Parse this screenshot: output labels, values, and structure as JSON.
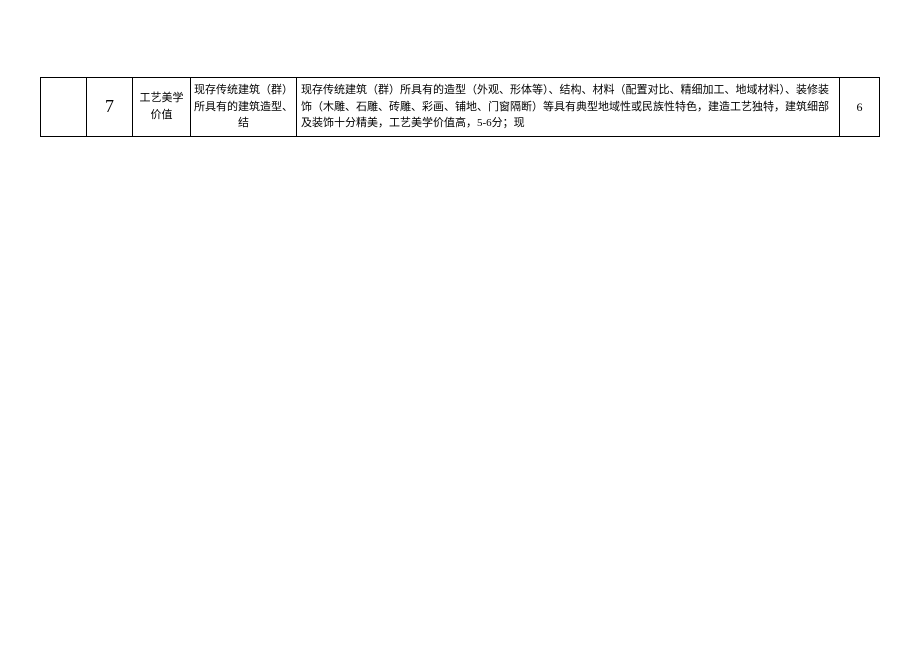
{
  "table": {
    "row": {
      "blank": "",
      "num": "7",
      "title": "工艺美学价值",
      "desc": "现存传统建筑（群）所具有的建筑造型、结",
      "detail": "现存传统建筑（群）所具有的造型（外观、形体等）、结构、材料（配置对比、精细加工、地域材料）、装修装饰（木雕、石雕、砖雕、彩画、铺地、门窗隔断）等具有典型地域性或民族性特色，建造工艺独特，建筑细部及装饰十分精美，工艺美学价值高，5-6分；现",
      "score": "6"
    }
  }
}
